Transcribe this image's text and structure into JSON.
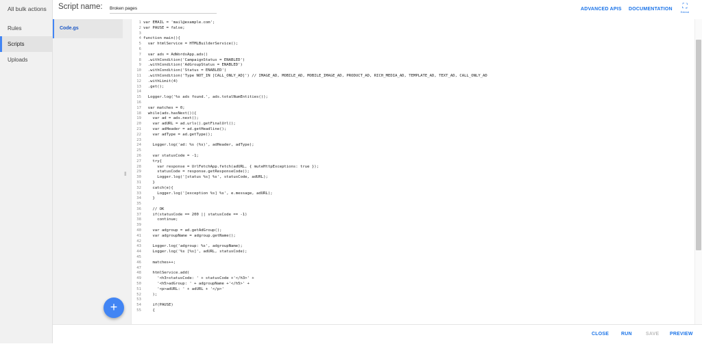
{
  "nav": {
    "all_bulk_actions": "All bulk actions",
    "items": [
      {
        "label": "Rules"
      },
      {
        "label": "Scripts"
      },
      {
        "label": "Uploads"
      }
    ]
  },
  "header": {
    "script_name_label": "Script name:",
    "script_name_value": "Broken pages",
    "advanced_apis": "ADVANCED APIS",
    "documentation": "DOCUMENTATION",
    "expand_label": "Extend"
  },
  "files": [
    {
      "name": "Code.gs"
    }
  ],
  "editor": {
    "lines": [
      "var EMAIL = 'mail@example.com';",
      "var PAUSE = false;",
      "",
      "function main(){",
      "  var htmlService = HTMLBuilderService();",
      "",
      "  var ads = AdWordsApp.ads()",
      "  .withCondition('CampaignStatus = ENABLED')",
      "  .withCondition('AdGroupStatus = ENABLED')",
      "  .withCondition('Status = ENABLED')",
      "  .withCondition('Type NOT_IN [CALL_ONLY_AD]') // IMAGE_AD, MOBILE_AD, MOBILE_IMAGE_AD, PRODUCT_AD, RICH_MEDIA_AD, TEMPLATE_AD, TEXT_AD, CALL_ONLY_AD",
      "  .withLimit(4)",
      "  .get();",
      "",
      "  Logger.log('%s ads found.', ads.totalNumEntities());",
      "",
      "  var matches = 0;",
      "  while(ads.hasNext()){",
      "    var ad = ads.next();",
      "    var adURL = ad.urls().getFinalUrl();",
      "    var adHeader = ad.getHeadline();",
      "    var adType = ad.getType();",
      "",
      "    Logger.log('ad: %s (%s)', adHeader, adType);",
      "",
      "    var statusCode = -1;",
      "    try{",
      "      var response = UrlFetchApp.fetch(adURL, { muteHttpExceptions: true });",
      "      statusCode = response.getResponseCode();",
      "      Logger.log('[status %s] %s', statusCode, adURL);",
      "    }",
      "    catch(e){",
      "      Logger.log('[exception %s] %s', e.message, adURL);",
      "    }",
      "",
      "    // OK",
      "    if(statusCode == 200 || statusCode == -1)",
      "      continue;",
      "",
      "    var adgroup = ad.getAdGroup();",
      "    var adgroupName = adgroup.getName();",
      "",
      "    Logger.log('adgroup: %s', adgroupName);",
      "    Logger.log('%s [%s]', adURL, statusCode);",
      "",
      "    matches++;",
      "",
      "    htmlService.add(",
      "      '<h3>statusCode: ' + statusCode +'</h3>' +",
      "      '<h5>adGroup: ' + adgroupName +'</h5>' +",
      "      '<p>adURL: ' + adURL + '</p>'",
      "    );",
      "",
      "    if(PAUSE)",
      "    {"
    ]
  },
  "footer": {
    "close": "CLOSE",
    "run": "RUN",
    "save": "SAVE",
    "preview": "PREVIEW"
  },
  "fab": {
    "label": "+"
  },
  "colors": {
    "accent": "#1a73e8",
    "fab": "#4285f4",
    "nav_bg": "#f1f1f1"
  }
}
